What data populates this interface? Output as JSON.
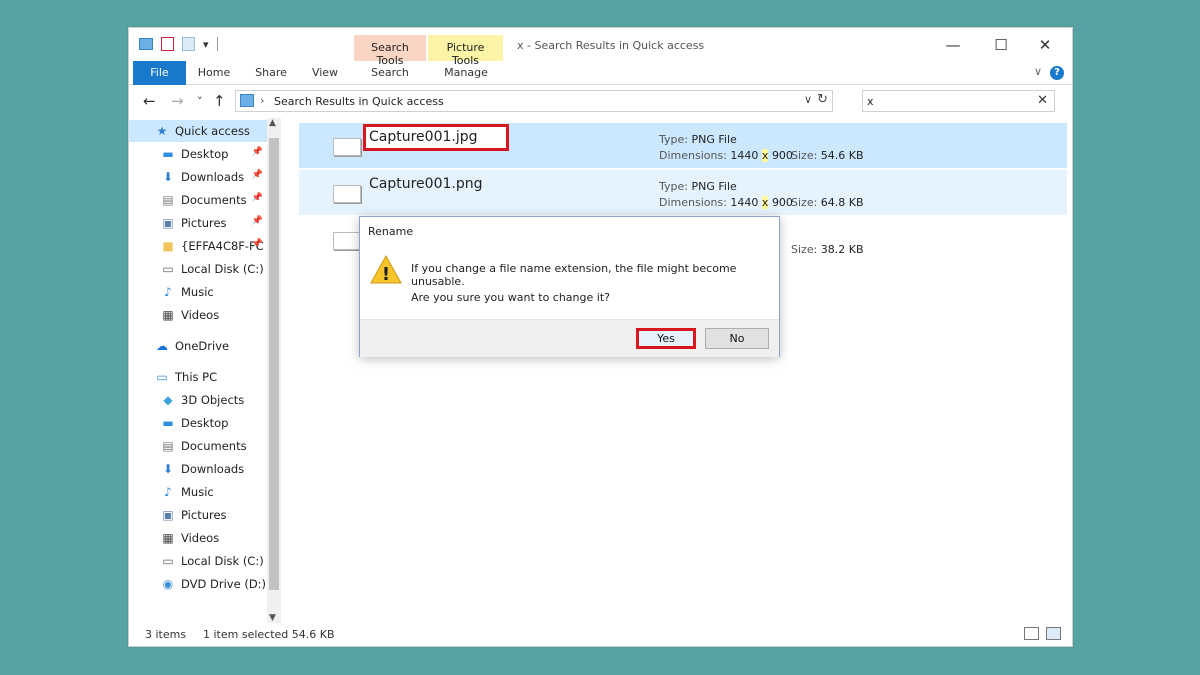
{
  "window": {
    "title": "x - Search Results in Quick access",
    "minimize_glyph": "—",
    "maximize_glyph": "☐",
    "close_glyph": "✕"
  },
  "quick_access_toolbar": {
    "dropdown_glyph": "▾"
  },
  "contextual_tabs": {
    "search_tools": "Search Tools",
    "picture_tools": "Picture Tools"
  },
  "ribbon": {
    "tabs": [
      "File",
      "Home",
      "Share",
      "View",
      "Search",
      "Manage"
    ],
    "collapse_glyph": "∨",
    "help_glyph": "?"
  },
  "nav": {
    "back_glyph": "←",
    "forward_glyph": "→",
    "recent_glyph": "˅",
    "up_glyph": "↑",
    "address_arrow": "›",
    "address_path": "Search Results in Quick access",
    "address_dropdown_glyph": "∨",
    "refresh_glyph": "↻",
    "search_value": "x",
    "search_clear_glyph": "✕"
  },
  "sidebar": {
    "scroll_up_glyph": "▲",
    "scroll_down_glyph": "▼",
    "items": [
      {
        "label": "Quick access",
        "icon": "star-icon",
        "glyph": "★",
        "indent": 1,
        "pinned": false,
        "selected": true,
        "color": "#2d7fd1"
      },
      {
        "label": "Desktop",
        "icon": "desktop-icon",
        "glyph": "▬",
        "indent": 2,
        "pinned": true,
        "color": "#2d8fe0"
      },
      {
        "label": "Downloads",
        "icon": "downloads-icon",
        "glyph": "⬇",
        "indent": 2,
        "pinned": true,
        "color": "#2d7fd1"
      },
      {
        "label": "Documents",
        "icon": "documents-icon",
        "glyph": "▤",
        "indent": 2,
        "pinned": true,
        "color": "#777777"
      },
      {
        "label": "Pictures",
        "icon": "pictures-icon",
        "glyph": "▣",
        "indent": 2,
        "pinned": true,
        "color": "#5a7fa8"
      },
      {
        "label": "{EFFA4C8F-FC",
        "icon": "folder-icon",
        "glyph": "■",
        "indent": 2,
        "pinned": true,
        "color": "#f2c55c"
      },
      {
        "label": "Local Disk (C:)",
        "icon": "disk-icon",
        "glyph": "▭",
        "indent": 2,
        "pinned": false,
        "color": "#666666"
      },
      {
        "label": "Music",
        "icon": "music-icon",
        "glyph": "♪",
        "indent": 2,
        "pinned": false,
        "color": "#2d7fd1"
      },
      {
        "label": "Videos",
        "icon": "videos-icon",
        "glyph": "▦",
        "indent": 2,
        "pinned": false,
        "color": "#444444"
      },
      {
        "label": "OneDrive",
        "icon": "onedrive-icon",
        "glyph": "☁",
        "indent": 1,
        "pinned": false,
        "gap": true,
        "color": "#1a73d9"
      },
      {
        "label": "This PC",
        "icon": "computer-icon",
        "glyph": "▭",
        "indent": 1,
        "pinned": false,
        "gap": true,
        "color": "#3b8fd9"
      },
      {
        "label": "3D Objects",
        "icon": "3d-objects-icon",
        "glyph": "◆",
        "indent": 2,
        "pinned": false,
        "color": "#3ba3d9"
      },
      {
        "label": "Desktop",
        "icon": "desktop-icon",
        "glyph": "▬",
        "indent": 2,
        "pinned": false,
        "color": "#2d8fe0"
      },
      {
        "label": "Documents",
        "icon": "documents-icon",
        "glyph": "▤",
        "indent": 2,
        "pinned": false,
        "color": "#777777"
      },
      {
        "label": "Downloads",
        "icon": "downloads-icon",
        "glyph": "⬇",
        "indent": 2,
        "pinned": false,
        "color": "#2d7fd1"
      },
      {
        "label": "Music",
        "icon": "music-icon",
        "glyph": "♪",
        "indent": 2,
        "pinned": false,
        "color": "#2d7fd1"
      },
      {
        "label": "Pictures",
        "icon": "pictures-icon",
        "glyph": "▣",
        "indent": 2,
        "pinned": false,
        "color": "#5a7fa8"
      },
      {
        "label": "Videos",
        "icon": "videos-icon",
        "glyph": "▦",
        "indent": 2,
        "pinned": false,
        "color": "#444444"
      },
      {
        "label": "Local Disk (C:)",
        "icon": "disk-icon",
        "glyph": "▭",
        "indent": 2,
        "pinned": false,
        "color": "#666666"
      },
      {
        "label": "DVD Drive (D:) C",
        "icon": "dvd-icon",
        "glyph": "◉",
        "indent": 2,
        "pinned": false,
        "color": "#3b8fd9"
      }
    ]
  },
  "files": [
    {
      "name": "Capture001.jpg",
      "type_label": "Type:",
      "type": "PNG File",
      "dim_label": "Dimensions:",
      "dim_w": "1440",
      "dim_x": "x",
      "dim_h": "900",
      "size_label": "Size:",
      "size": "54.6 KB",
      "state": "selected",
      "renaming": true
    },
    {
      "name": "Capture001.png",
      "type_label": "Type:",
      "type": "PNG File",
      "dim_label": "Dimensions:",
      "dim_w": "1440",
      "dim_x": "x",
      "dim_h": "900",
      "size_label": "Size:",
      "size": "64.8 KB",
      "state": "hover",
      "renaming": false
    },
    {
      "name": "",
      "size_label": "Size:",
      "size": "38.2 KB",
      "state": "normal",
      "renaming": false
    }
  ],
  "dialog": {
    "title": "Rename",
    "message": "If you change a file name extension, the file might become unusable.",
    "question": "Are you sure you want to change it?",
    "yes_label": "Yes",
    "no_label": "No",
    "warning_mark": "!"
  },
  "status": {
    "items": "3 items",
    "selected": "1 item selected  54.6 KB"
  },
  "colors": {
    "accent": "#1979ca",
    "highlight_box": "#d8161f",
    "selection": "#cce8ff",
    "background": "#57a3a3"
  }
}
